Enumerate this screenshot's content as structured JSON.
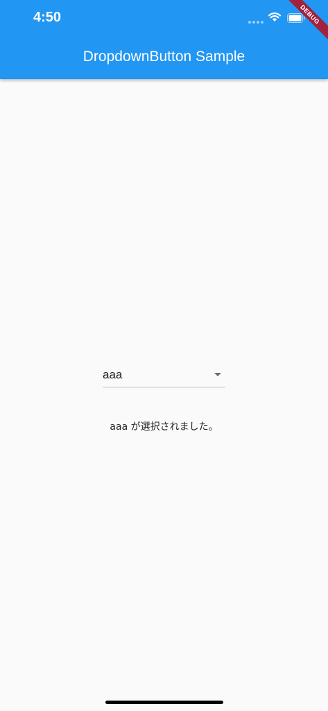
{
  "status_bar": {
    "time": "4:50",
    "signal_icon": "cellular-signal-icon",
    "wifi_icon": "wifi-icon",
    "battery_icon": "battery-icon"
  },
  "app_bar": {
    "title": "DropdownButton Sample",
    "color": "#2196f3"
  },
  "debug_banner": {
    "label": "DEBUG",
    "color": "#a0223f"
  },
  "dropdown": {
    "selected_value": "aaa",
    "arrow_icon": "arrow-drop-down-icon"
  },
  "result": {
    "text": "aaa が選択されました。"
  },
  "colors": {
    "background": "#fafafa",
    "text": "#222222"
  }
}
